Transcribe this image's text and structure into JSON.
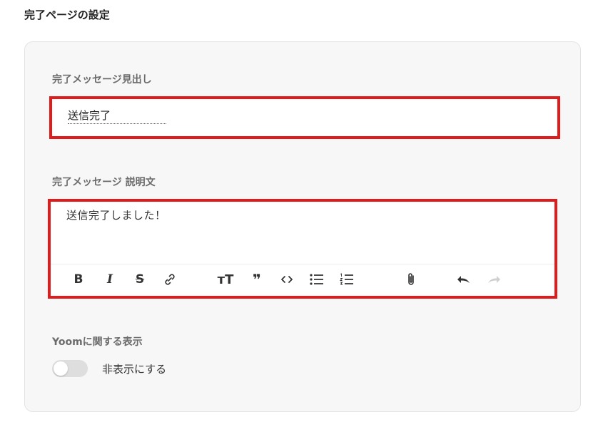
{
  "page": {
    "title": "完了ページの設定"
  },
  "completion": {
    "heading_label": "完了メッセージ見出し",
    "heading_value": "送信完了",
    "description_label": "完了メッセージ 説明文",
    "description_value": "送信完了しました！"
  },
  "toolbar": {
    "bold": "B",
    "italic": "I",
    "strike": "S",
    "heading": "ᴛT",
    "quote": "❞"
  },
  "yoom_display": {
    "label": "Yoomに関する表示",
    "toggle_label": "非表示にする",
    "toggle_on": false
  },
  "colors": {
    "highlight": "#e01b1b",
    "card_bg": "#f7f7f7"
  }
}
